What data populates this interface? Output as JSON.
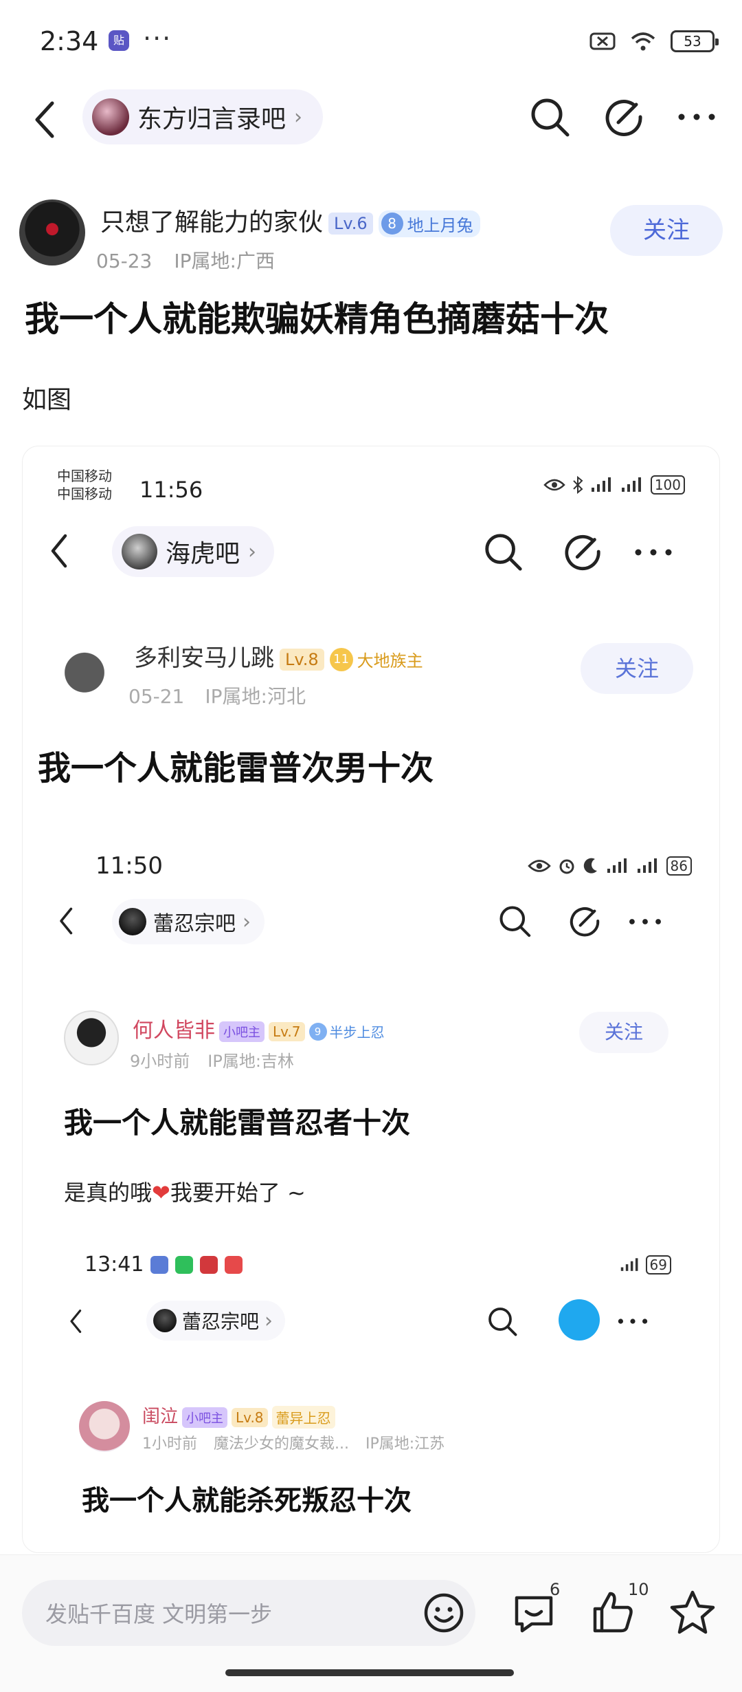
{
  "status": {
    "time": "2:34",
    "badge": "贴",
    "battery": "53"
  },
  "nav": {
    "forum_name": "东方归言录吧"
  },
  "post": {
    "author": "只想了解能力的家伙",
    "level": "Lv.6",
    "medal_num": "8",
    "medal_title": "地上月兔",
    "date": "05-23",
    "ip": "IP属地:广西",
    "follow": "关注",
    "title": "我一个人就能欺骗妖精角色摘蘑菇十次",
    "body": "如图"
  },
  "embedded": {
    "carrier1": "中国移动",
    "carrier2": "中国移动",
    "time": "11:56",
    "battery": "100",
    "forum_name": "海虎吧",
    "author": "多利安马儿跳",
    "level": "Lv.8",
    "medal_num": "11",
    "medal_title": "大地族主",
    "date": "05-21",
    "ip": "IP属地:河北",
    "follow": "关注",
    "title": "我一个人就能雷普次男十次",
    "nested": {
      "time": "11:50",
      "battery": "86",
      "forum_name": "蕾忍宗吧",
      "author": "何人皆非",
      "role_tag": "小吧主",
      "level": "Lv.7",
      "medal_num": "9",
      "medal_title": "半步上忍",
      "time_ago": "9小时前",
      "ip": "IP属地:吉林",
      "follow": "关注",
      "title": "我一个人就能雷普忍者十次",
      "body_before": "是真的哦",
      "body_after": "我要开始了 ~",
      "nested2": {
        "time": "13:41",
        "battery": "69",
        "forum_name": "蕾忍宗吧",
        "author": "闺泣",
        "role_tag": "小吧主",
        "level": "Lv.8",
        "medal_title": "蕾异上忍",
        "time_ago": "1小时前",
        "subtitle": "魔法少女的魔女裁...",
        "ip": "IP属地:江苏",
        "title": "我一个人就能杀死叛忍十次"
      }
    }
  },
  "bottom": {
    "placeholder": "发贴千百度 文明第一步",
    "comment_count": "6",
    "like_count": "10"
  },
  "icons": [
    "back-arrow-icon",
    "search-icon",
    "edit-icon",
    "more-icon",
    "emoji-icon",
    "comment-icon",
    "like-icon",
    "star-icon",
    "wifi-icon",
    "battery-icon"
  ]
}
